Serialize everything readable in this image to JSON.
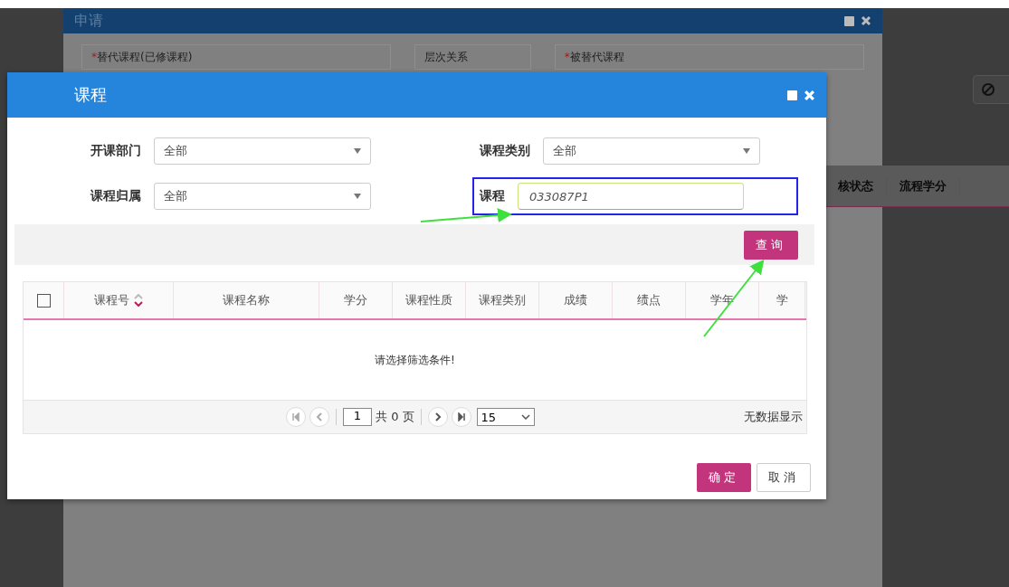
{
  "background_page": {
    "table_columns": [
      "核状态",
      "流程学分"
    ]
  },
  "back_dialog": {
    "title": "申请",
    "fields": [
      {
        "label": "替代课程(已修课程)",
        "required_mark": "*"
      },
      {
        "label": "层次关系"
      },
      {
        "label": "被替代课程",
        "required_mark": "*"
      }
    ]
  },
  "dialog": {
    "title": "课程",
    "filters": [
      {
        "label": "开课部门",
        "kind": "select",
        "value": "全部",
        "highlighted": false
      },
      {
        "label": "课程类别",
        "kind": "select",
        "value": "全部",
        "highlighted": false
      },
      {
        "label": "课程归属",
        "kind": "select",
        "value": "全部",
        "highlighted": false
      },
      {
        "label": "课程",
        "kind": "input",
        "value": "033087P1",
        "highlighted": true
      }
    ],
    "search_button": "查询",
    "table": {
      "select_all_checked": false,
      "columns": [
        {
          "label": "课程号",
          "sortable": true
        },
        {
          "label": "课程名称"
        },
        {
          "label": "学分"
        },
        {
          "label": "课程性质"
        },
        {
          "label": "课程类别"
        },
        {
          "label": "成绩"
        },
        {
          "label": "绩点"
        },
        {
          "label": "学年"
        },
        {
          "label": "学"
        }
      ],
      "empty_message": "请选择筛选条件!"
    },
    "pager": {
      "page": "1",
      "total": "共 0 页",
      "page_size": "15",
      "status": "无数据显示"
    },
    "buttons": [
      {
        "label": "确定",
        "kind": "primary"
      },
      {
        "label": "取消",
        "kind": "default"
      }
    ]
  }
}
